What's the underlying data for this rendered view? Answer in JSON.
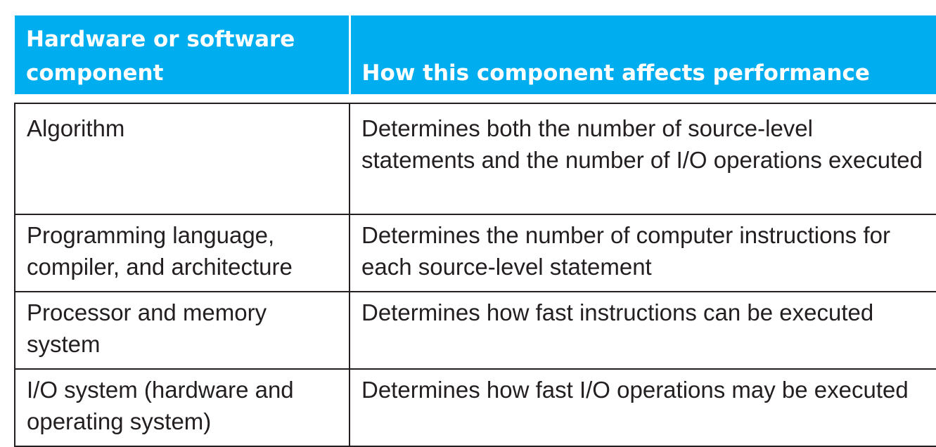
{
  "table": {
    "headers": [
      "Hardware or software component",
      "How this component affects performance"
    ],
    "rows": [
      {
        "component": "Algorithm",
        "effect": "Determines both the number of source-level statements and the number of I/O operations executed"
      },
      {
        "component": "Programming language, compiler, and architecture",
        "effect": "Determines the number of computer instructions for each source-level statement"
      },
      {
        "component": "Processor and memory system",
        "effect": "Determines how fast instructions can be executed"
      },
      {
        "component": "I/O system (hardware and operating system)",
        "effect": "Determines how fast I/O operations may be executed"
      }
    ]
  },
  "colors": {
    "header_background": "#00aeef",
    "header_text": "#ffffff",
    "body_text": "#231f20",
    "rule": "#231f20"
  }
}
